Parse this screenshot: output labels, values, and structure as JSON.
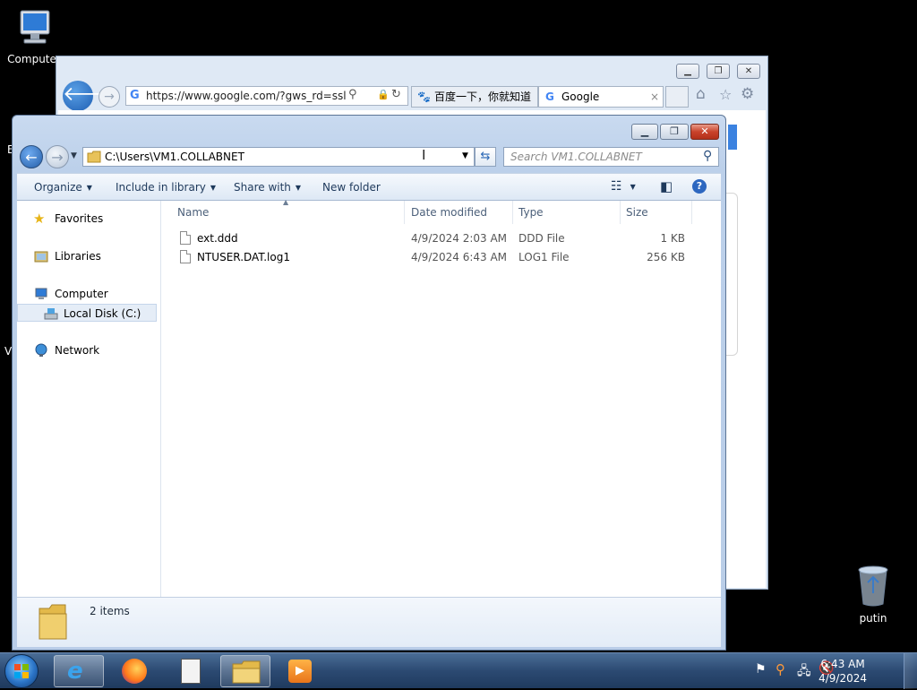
{
  "desktop": {
    "icons": [
      {
        "label": "Computer"
      },
      {
        "label": "putin"
      }
    ],
    "left_edge_glyphs": [
      "E",
      "V"
    ]
  },
  "ie": {
    "url": "https://www.google.com/?gws_rd=ssl",
    "tabs": [
      {
        "label": "百度一下，你就知道"
      },
      {
        "label": "Google"
      }
    ],
    "tab_close": "×"
  },
  "explorer": {
    "address": "C:\\Users\\VM1.COLLABNET",
    "search_placeholder": "Search VM1.COLLABNET",
    "toolbar": {
      "organize": "Organize",
      "include_in_library": "Include in library",
      "share_with": "Share with",
      "new_folder": "New folder"
    },
    "nav": {
      "favorites": "Favorites",
      "libraries": "Libraries",
      "computer": "Computer",
      "local_disk": "Local Disk (C:)",
      "network": "Network"
    },
    "columns": {
      "name": "Name",
      "date_modified": "Date modified",
      "type": "Type",
      "size": "Size"
    },
    "files": [
      {
        "name": "ext.ddd",
        "date": "4/9/2024 2:03 AM",
        "type": "DDD File",
        "size": "1 KB"
      },
      {
        "name": "NTUSER.DAT.log1",
        "date": "4/9/2024 6:43 AM",
        "type": "LOG1 File",
        "size": "256 KB"
      }
    ],
    "status": "2 items"
  },
  "taskbar": {
    "time": "6:43 AM",
    "date": "4/9/2024"
  }
}
